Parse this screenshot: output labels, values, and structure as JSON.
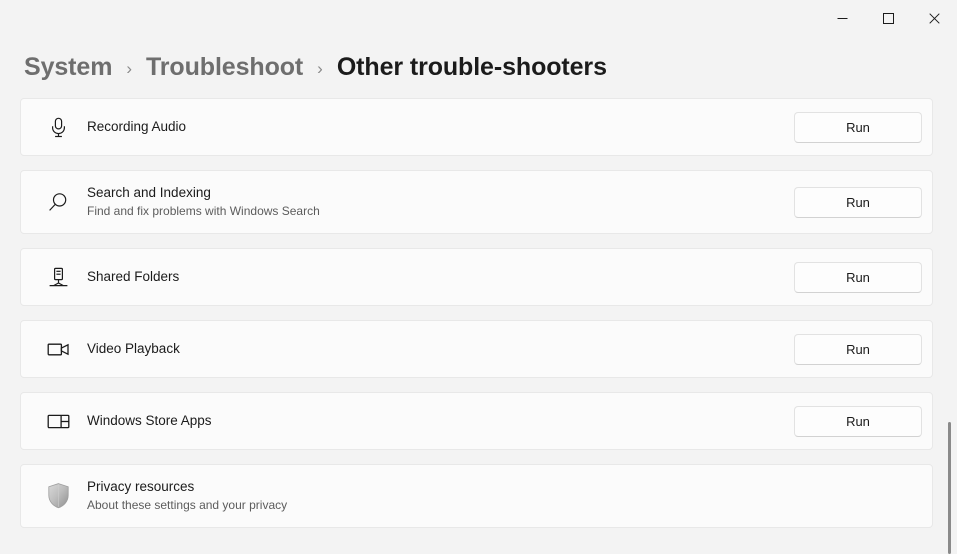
{
  "window": {
    "controls": [
      {
        "name": "minimize",
        "label": "Minimize"
      },
      {
        "name": "maximize",
        "label": "Maximize"
      },
      {
        "name": "close",
        "label": "Close"
      }
    ],
    "titlebar_color": "#f3f3f3"
  },
  "breadcrumb": {
    "separator": "›",
    "items": [
      {
        "label": "System",
        "current": false
      },
      {
        "label": "Troubleshoot",
        "current": false
      },
      {
        "label": "Other trouble-shooters",
        "current": true
      }
    ]
  },
  "troubleshooters": [
    {
      "title": "Recording Audio",
      "subtitle": "",
      "icon": "microphone-icon",
      "action": "Run"
    },
    {
      "title": "Search and Indexing",
      "subtitle": "Find and fix problems with Windows Search",
      "icon": "search-icon",
      "action": "Run"
    },
    {
      "title": "Shared Folders",
      "subtitle": "",
      "icon": "shared-folders-icon",
      "action": "Run"
    },
    {
      "title": "Video Playback",
      "subtitle": "",
      "icon": "video-camera-icon",
      "action": "Run"
    },
    {
      "title": "Windows Store Apps",
      "subtitle": "",
      "icon": "store-apps-icon",
      "action": "Run"
    }
  ],
  "privacy": {
    "title": "Privacy resources",
    "subtitle": "About these settings and your privacy",
    "icon": "shield-icon"
  },
  "colors": {
    "page_background": "#f3f3f3",
    "card_background": "#fbfbfb",
    "card_border": "#e8e8e8",
    "text_primary": "#1b1b1b",
    "text_secondary": "#5c5c5c",
    "crumb_inactive": "#6e6e6e",
    "scrollbar_thumb": "#8a8a8a"
  },
  "scrollbar": {
    "thumb_top_pct": 71,
    "thumb_height_pct": 29
  }
}
